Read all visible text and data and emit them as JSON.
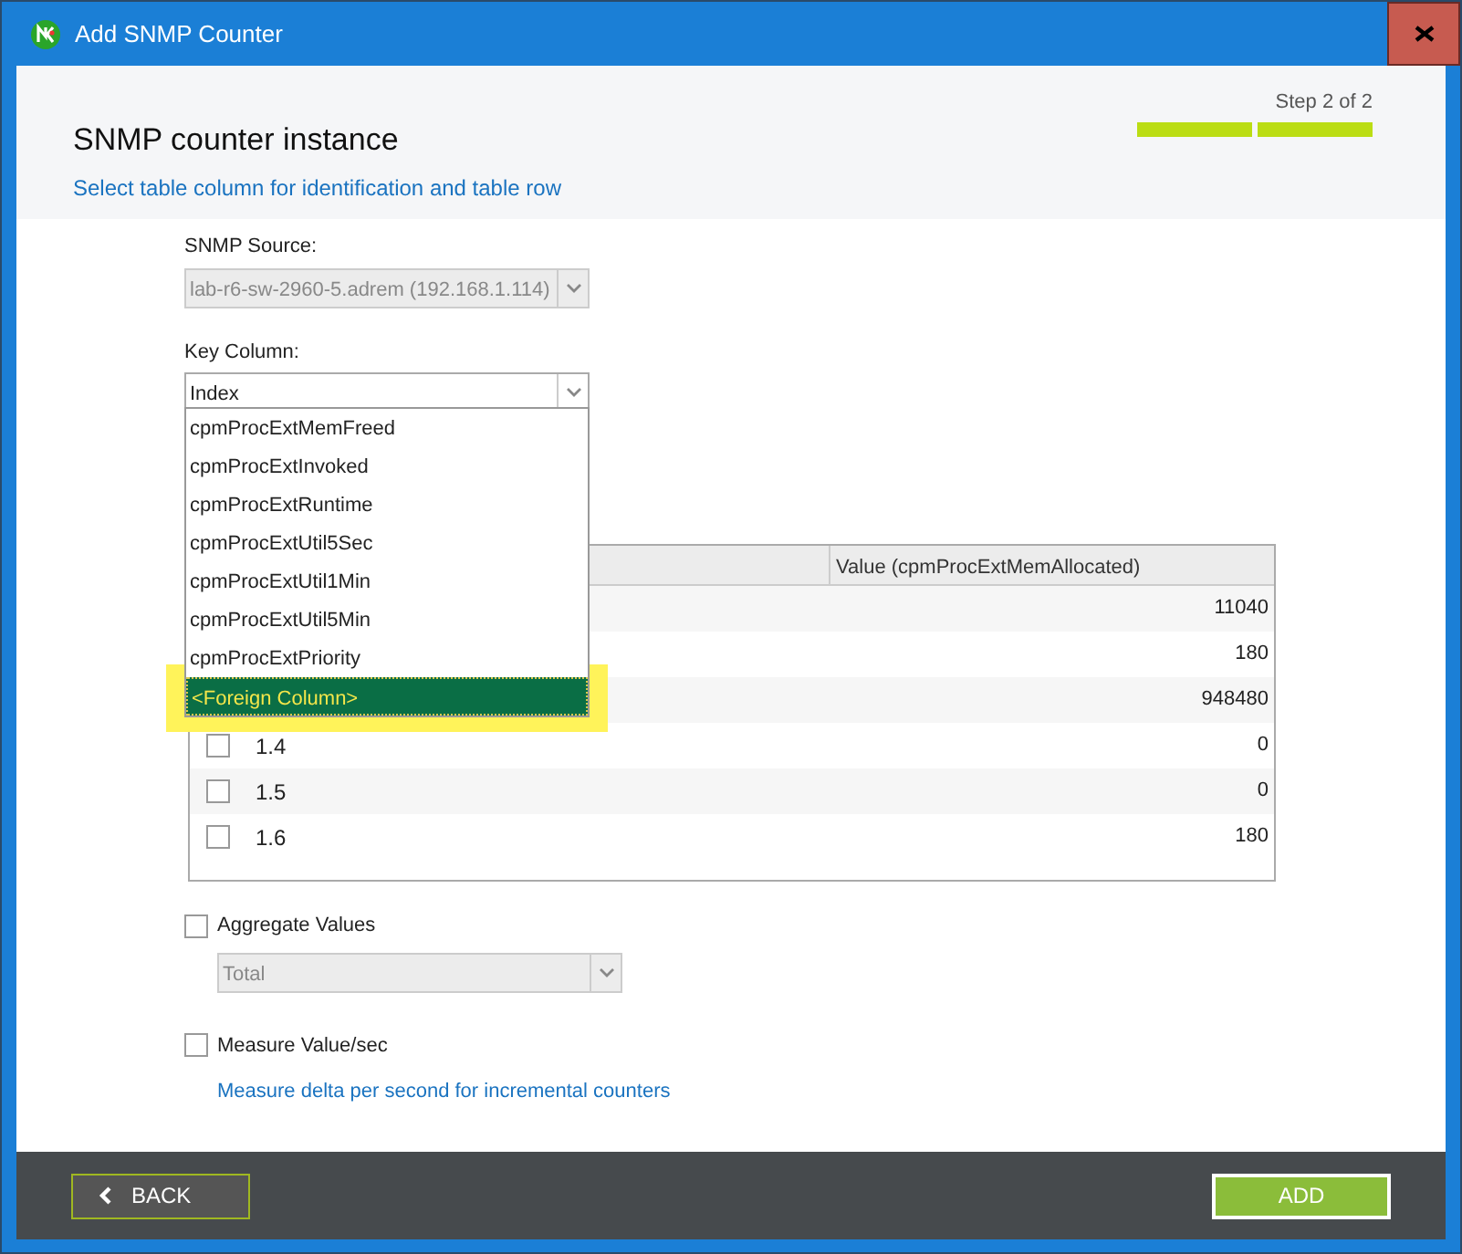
{
  "window": {
    "title": "Add SNMP Counter"
  },
  "header": {
    "title": "SNMP counter instance",
    "subtitle": "Select table column for identification and table row",
    "step": "Step 2 of 2",
    "steps": [
      {
        "done": true
      },
      {
        "done": true
      }
    ]
  },
  "snmp_source": {
    "label": "SNMP Source:",
    "value": "lab-r6-sw-2960-5.adrem (192.168.1.114)",
    "disabled": true
  },
  "key_column": {
    "label": "Key Column:",
    "value": "Index",
    "expanded": true,
    "options": [
      {
        "label": "cpmProcExtMemFreed",
        "selected": false
      },
      {
        "label": "cpmProcExtInvoked",
        "selected": false
      },
      {
        "label": "cpmProcExtRuntime",
        "selected": false
      },
      {
        "label": "cpmProcExtUtil5Sec",
        "selected": false
      },
      {
        "label": "cpmProcExtUtil1Min",
        "selected": false
      },
      {
        "label": "cpmProcExtUtil5Min",
        "selected": false
      },
      {
        "label": "cpmProcExtPriority",
        "selected": false
      },
      {
        "label": "<Foreign Column>",
        "selected": true
      }
    ]
  },
  "table": {
    "columns": [
      "Value (cpmProcExtMemAllocated)"
    ],
    "rows": [
      {
        "value": "11040"
      },
      {
        "value": "180"
      },
      {
        "value": "948480"
      },
      {
        "label": "1.4",
        "checked": false,
        "value": "0"
      },
      {
        "label": "1.5",
        "checked": false,
        "value": "0"
      },
      {
        "label": "1.6",
        "checked": false,
        "value": "180"
      }
    ]
  },
  "aggregate": {
    "label": "Aggregate Values",
    "checked": false,
    "select": {
      "value": "Total",
      "disabled": true
    }
  },
  "measure": {
    "label": "Measure Value/sec",
    "checked": false,
    "hint": "Measure delta per second for incremental counters"
  },
  "buttons": [
    {
      "label": "BACK",
      "kind": "back"
    },
    {
      "label": "ADD",
      "kind": "primary"
    }
  ]
}
